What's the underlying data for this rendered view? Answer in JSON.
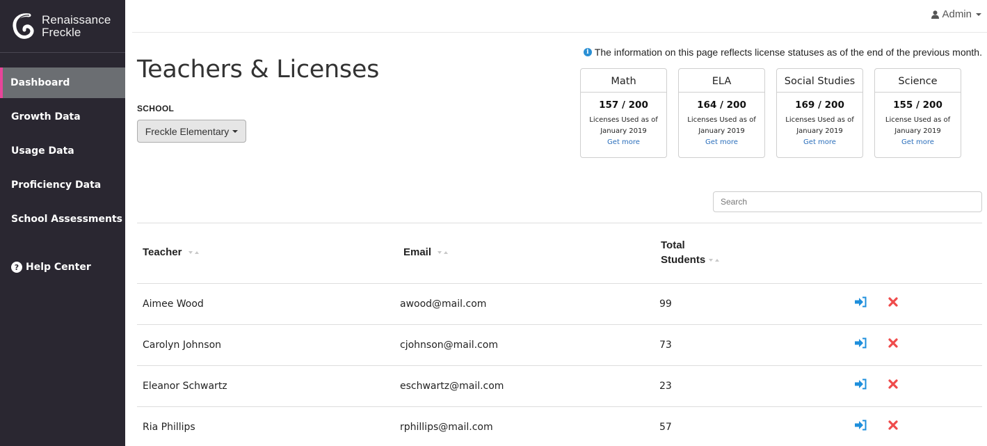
{
  "brand": {
    "line1": "Renaissance",
    "line2": "Freckle"
  },
  "sidebar": {
    "items": [
      {
        "label": "Dashboard",
        "active": true
      },
      {
        "label": "Growth Data",
        "active": false
      },
      {
        "label": "Usage Data",
        "active": false
      },
      {
        "label": "Proficiency Data",
        "active": false
      },
      {
        "label": "School Assessments",
        "active": false
      }
    ],
    "help": {
      "icon": "question-circle-icon",
      "label": "Help Center"
    }
  },
  "topbar": {
    "user_icon": "user-icon",
    "user_label": "Admin"
  },
  "page": {
    "title": "Teachers & Licenses",
    "school_label": "SCHOOL",
    "school_selected": "Freckle Elementary",
    "info_note": "The information on this page reflects license statuses as of the end of the previous month."
  },
  "licenses": [
    {
      "subject": "Math",
      "count": "157 / 200",
      "caption": "Licenses Used as of",
      "period": "January 2019",
      "link": "Get more"
    },
    {
      "subject": "ELA",
      "count": "164 / 200",
      "caption": "Licenses Used as of",
      "period": "January 2019",
      "link": "Get more"
    },
    {
      "subject": "Social Studies",
      "count": "169 / 200",
      "caption": "Licenses Used as of",
      "period": "January 2019",
      "link": "Get more"
    },
    {
      "subject": "Science",
      "count": "155 / 200",
      "caption": "License Used as of",
      "period": "January 2019",
      "link": "Get more"
    }
  ],
  "search": {
    "placeholder": "Search",
    "value": ""
  },
  "table": {
    "headers": {
      "teacher": "Teacher",
      "email": "Email",
      "total_line1": "Total",
      "total_line2": "Students"
    },
    "rows": [
      {
        "teacher": "Aimee Wood",
        "email": "awood@mail.com",
        "students": "99"
      },
      {
        "teacher": "Carolyn Johnson",
        "email": "cjohnson@mail.com",
        "students": "73"
      },
      {
        "teacher": "Eleanor Schwartz",
        "email": "eschwartz@mail.com",
        "students": "23"
      },
      {
        "teacher": "Ria Phillips",
        "email": "rphillips@mail.com",
        "students": "57"
      }
    ],
    "row_actions": {
      "login_icon": "sign-in-icon",
      "remove_icon": "remove-x-icon"
    }
  },
  "colors": {
    "sidebar_bg": "#2a2731",
    "active_bg": "#6b6e72",
    "active_accent": "#e8459a",
    "link": "#2a6ebb",
    "login_icon": "#1e8fdc",
    "remove_icon": "#ef4b4b",
    "info_icon": "#2a8fd4"
  }
}
